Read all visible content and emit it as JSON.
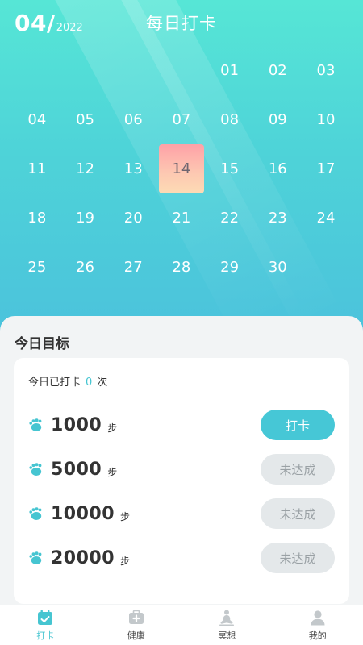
{
  "header": {
    "month": "04/",
    "year": "2022",
    "title": "每日打卡"
  },
  "calendar": {
    "leading_blanks": 4,
    "days": [
      "01",
      "02",
      "03",
      "04",
      "05",
      "06",
      "07",
      "08",
      "09",
      "10",
      "11",
      "12",
      "13",
      "14",
      "15",
      "16",
      "17",
      "18",
      "19",
      "20",
      "21",
      "22",
      "23",
      "24",
      "25",
      "26",
      "27",
      "28",
      "29",
      "30"
    ],
    "selected": "14"
  },
  "goals": {
    "title": "今日目标",
    "count_prefix": "今日已打卡",
    "count": "0",
    "count_suffix": "次",
    "unit": "步",
    "items": [
      {
        "steps": "1000",
        "button": "打卡",
        "state": "active"
      },
      {
        "steps": "5000",
        "button": "未达成",
        "state": "disabled"
      },
      {
        "steps": "10000",
        "button": "未达成",
        "state": "disabled"
      },
      {
        "steps": "20000",
        "button": "未达成",
        "state": "disabled"
      }
    ]
  },
  "tabs": [
    {
      "label": "打卡",
      "icon": "calendar-check-icon",
      "selected": true
    },
    {
      "label": "健康",
      "icon": "medical-kit-icon",
      "selected": false
    },
    {
      "label": "冥想",
      "icon": "meditation-icon",
      "selected": false
    },
    {
      "label": "我的",
      "icon": "user-icon",
      "selected": false
    }
  ],
  "colors": {
    "accent": "#46c5d1",
    "today_top": "#fea1a7",
    "today_bottom": "#fddbb4",
    "disabled_bg": "#e4e8ea"
  }
}
